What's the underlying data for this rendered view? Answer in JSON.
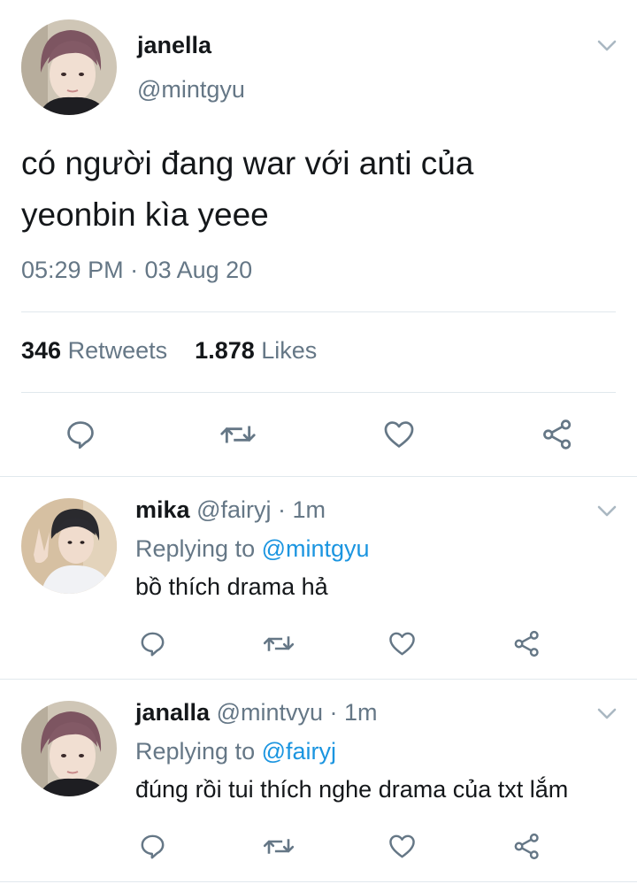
{
  "main_tweet": {
    "display_name": "janella",
    "handle": "@mintgyu",
    "text_line1": "có người đang war với anti của",
    "text_line2": "yeonbin kìa yeee",
    "timestamp": "05:29 PM · 03 Aug 20",
    "retweets_count": "346",
    "retweets_label": "Retweets",
    "likes_count": "1.878",
    "likes_label": "Likes"
  },
  "replies": [
    {
      "display_name": "mika",
      "handle": "@fairyj",
      "time": "· 1m",
      "replying_prefix": "Replying to",
      "replying_to": "@mintgyu",
      "text": "bồ thích drama hả"
    },
    {
      "display_name": "janalla",
      "handle": "@mintvyu",
      "time": "· 1m",
      "replying_prefix": "Replying to",
      "replying_to": "@fairyj",
      "text": "đúng rồi tui thích nghe drama của txt lắm"
    }
  ],
  "icons": [
    "chevron-down-icon",
    "reply-icon",
    "retweet-icon",
    "like-icon",
    "share-icon"
  ],
  "colors": {
    "text": "#14171a",
    "muted": "#657786",
    "link": "#1b95e0",
    "divider": "#e1e8ed"
  }
}
